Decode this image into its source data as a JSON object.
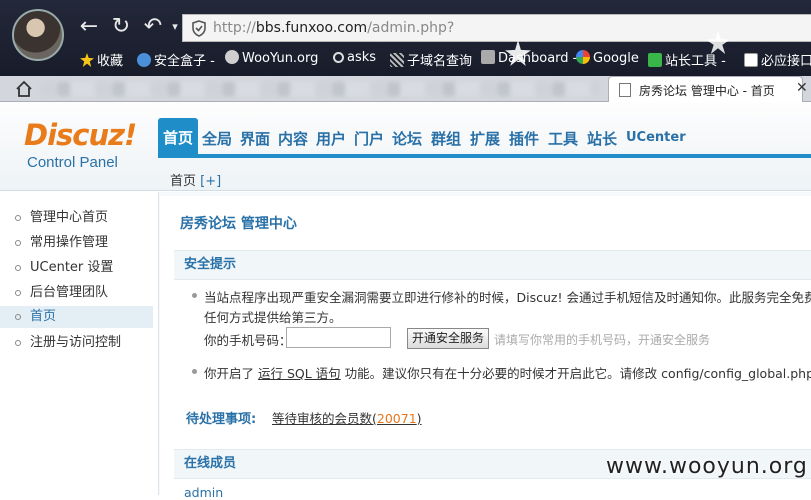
{
  "browser": {
    "url_prefix": "http://",
    "url_host": "bbs.funxoo.com",
    "url_path": "/admin.php?",
    "bookmarks": [
      {
        "label": "收藏",
        "icon": "star-icon",
        "color": "#f5c518"
      },
      {
        "label": "安全盒子 -",
        "icon": "fox-icon",
        "color": "#4a90d9"
      },
      {
        "label": "WooYun.org",
        "icon": "cloud-icon",
        "color": "#cfcfcf"
      },
      {
        "label": "asks",
        "icon": "search-icon",
        "color": "#dddddd"
      },
      {
        "label": "子域名查询",
        "icon": "grid-icon",
        "color": "#bbbbbb"
      },
      {
        "label": "Dashboard -",
        "icon": "dashboard-icon",
        "color": "#aaaaaa"
      },
      {
        "label": "Google",
        "icon": "google-icon",
        "color": "#4285f4"
      },
      {
        "label": "站长工具 -",
        "icon": "tools-icon",
        "color": "#39b54a"
      },
      {
        "label": "必应接口(",
        "icon": "page-icon",
        "color": "#ffffff"
      }
    ],
    "active_tab_title": "房秀论坛 管理中心 - 首页"
  },
  "header": {
    "logo_main": "Discuz",
    "logo_bang": "!",
    "logo_sub": "Control Panel",
    "nav": [
      "首页",
      "全局",
      "界面",
      "内容",
      "用户",
      "门户",
      "论坛",
      "群组",
      "扩展",
      "插件",
      "工具",
      "站长",
      "UCenter"
    ],
    "breadcrumb_home": "首页",
    "breadcrumb_plus": "[+]"
  },
  "sidebar": {
    "items": [
      {
        "label": "管理中心首页",
        "active": false
      },
      {
        "label": "常用操作管理",
        "active": false
      },
      {
        "label": "UCenter 设置",
        "active": false
      },
      {
        "label": "后台管理团队",
        "active": false
      },
      {
        "label": "首页",
        "active": true
      },
      {
        "label": "注册与访问控制",
        "active": false
      }
    ]
  },
  "main": {
    "title": "房秀论坛 管理中心",
    "security_heading": "安全提示",
    "notice_line1": "当站点程序出现严重安全漏洞需要立即进行修补的时候，Discuz! 会通过手机短信及时通知你。此服务完全免费，",
    "notice_line2": "任何方式提供给第三方。",
    "phone_label": "你的手机号码：",
    "phone_value": "",
    "phone_button": "开通安全服务",
    "phone_hint": "请填写你常用的手机号码，开通安全服务",
    "sql_prefix": "你开启了",
    "sql_link": "运行 SQL 语句",
    "sql_suffix": "功能。建议你只有在十分必要的时候才开启此它。请修改",
    "sql_file": "config/config_global.php 关闭",
    "pending_label": "待处理事项:",
    "pending_text": "等待审核的会员数",
    "pending_open": "(",
    "pending_count": "20071",
    "pending_close": ")",
    "online_heading": "在线成员",
    "online_user": "admin"
  },
  "watermark": "www.wooyun.org",
  "colors": {
    "accent": "#1f8ec8",
    "brand_orange": "#e87b1a",
    "link_blue": "#2a71a8"
  }
}
